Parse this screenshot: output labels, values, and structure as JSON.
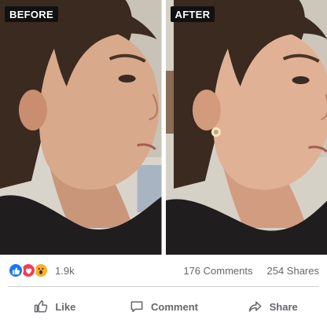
{
  "post": {
    "photos": [
      {
        "label": "BEFORE"
      },
      {
        "label": "AFTER"
      }
    ]
  },
  "reactions": {
    "icons": [
      "like-reaction-icon",
      "love-reaction-icon",
      "wow-reaction-icon"
    ],
    "count": "1.9k",
    "colors": {
      "like": "#1877f2",
      "love": "#f33e58",
      "wow": "#f7b125"
    }
  },
  "stats": {
    "comments": "176 Comments",
    "shares": "254 Shares"
  },
  "actions": {
    "like_label": "Like",
    "comment_label": "Comment",
    "share_label": "Share"
  },
  "colors": {
    "text_secondary": "#65676b",
    "divider": "#ced0d4"
  }
}
